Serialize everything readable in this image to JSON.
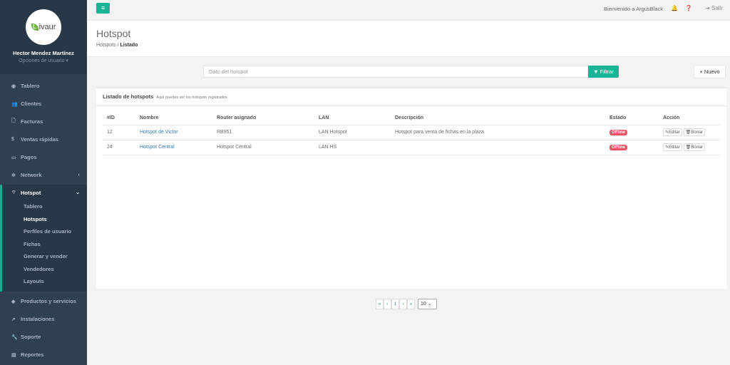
{
  "profile": {
    "logo_text": "ivaur",
    "logo_letter": "L",
    "name": "Hector Mendez Martínez",
    "options": "Opciones de usuario ▾"
  },
  "nav": [
    {
      "id": "tablero",
      "label": "Tablero",
      "icon": "dashboard-icon",
      "glyph": "◉"
    },
    {
      "id": "clientes",
      "label": "Clientes",
      "icon": "users-icon",
      "glyph": "👥"
    },
    {
      "id": "facturas",
      "label": "Facturas",
      "icon": "file-icon",
      "glyph": "🗋"
    },
    {
      "id": "ventas",
      "label": "Ventas rápidas",
      "icon": "dollar-icon",
      "glyph": "$"
    },
    {
      "id": "pagos",
      "label": "Pagos",
      "icon": "card-icon",
      "glyph": "▭"
    },
    {
      "id": "network",
      "label": "Network",
      "icon": "network-icon",
      "glyph": "✲"
    },
    {
      "id": "hotspot",
      "label": "Hotspot",
      "icon": "wifi-icon",
      "glyph": "⌔"
    },
    {
      "id": "productos",
      "label": "Productos y servicios",
      "icon": "tag-icon",
      "glyph": "◆"
    },
    {
      "id": "instalaciones",
      "label": "Instalaciones",
      "icon": "rocket-icon",
      "glyph": "➚"
    },
    {
      "id": "soporte",
      "label": "Soporte",
      "icon": "wrench-icon",
      "glyph": "🔧"
    },
    {
      "id": "reportes",
      "label": "Reportes",
      "icon": "book-icon",
      "glyph": "▤"
    }
  ],
  "hotspot_sub": [
    "Tablero",
    "Hotspots",
    "Perfiles de usuario",
    "Fichas",
    "Generar y vender",
    "Vendedores",
    "Layouts"
  ],
  "topbar": {
    "welcome": "Bienvenido a ArgusBlack",
    "logout": "Salir"
  },
  "heading": {
    "title": "Hotspot",
    "crumb_parent": "Hotspots",
    "crumb_current": "Listado"
  },
  "filter": {
    "placeholder": "Dato del hotspot",
    "button": "Filtrar",
    "new_button": "Nuevo"
  },
  "panel": {
    "title": "Listado de hotspots",
    "subtitle": "Aquí puedes ver los hotspots registrados"
  },
  "table": {
    "headers": [
      "#ID",
      "Nombre",
      "Router asignado",
      "LAN",
      "Descripción",
      "Estado",
      "Acción"
    ],
    "rows": [
      {
        "id": "12",
        "name": "Hotspot de Victor",
        "router": "RB951",
        "lan": "LAN Hotspot",
        "desc": "Hotspot para venta de fichas en la plaza",
        "status": "Offline"
      },
      {
        "id": "24",
        "name": "Hotspot Central",
        "router": "Hotspot Central",
        "lan": "LAN HS",
        "desc": "",
        "status": "Offline"
      }
    ],
    "edit_label": "Editar",
    "delete_label": "Borrar"
  },
  "pager": {
    "first": "«",
    "prev": "‹",
    "page": "1",
    "next": "›",
    "last": "»",
    "size": "10"
  },
  "colors": {
    "accent": "#1ab394",
    "sidebar": "#2f4050",
    "danger": "#ed5565"
  }
}
